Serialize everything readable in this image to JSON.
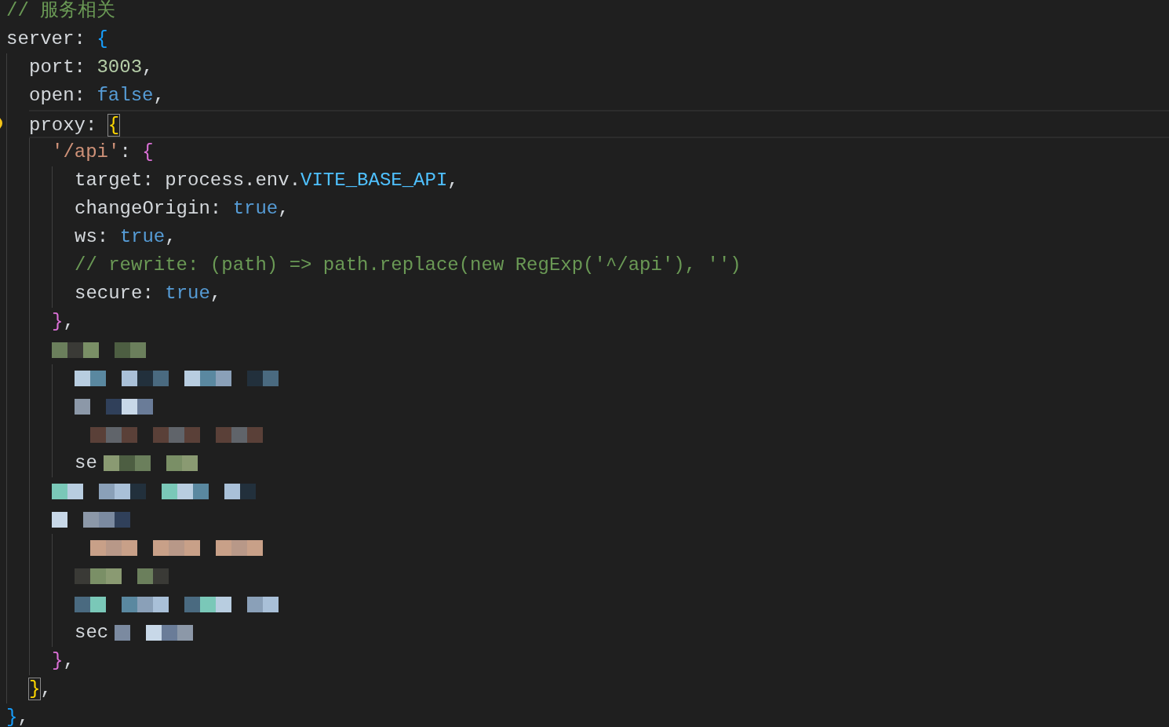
{
  "editor": {
    "lines": [
      {
        "kind": "code",
        "tokens": [
          {
            "kind": "comment",
            "text": "// 服务相关"
          }
        ]
      },
      {
        "kind": "code",
        "tokens": [
          {
            "kind": "key",
            "text": "server"
          },
          {
            "kind": "punct",
            "text": ": "
          },
          {
            "kind": "brace1",
            "text": "{"
          }
        ],
        "children": [
          {
            "kind": "code",
            "tokens": [
              {
                "kind": "key",
                "text": "port"
              },
              {
                "kind": "punct",
                "text": ": "
              },
              {
                "kind": "number",
                "text": "3003"
              },
              {
                "kind": "punct",
                "text": ","
              }
            ]
          },
          {
            "kind": "code",
            "tokens": [
              {
                "kind": "key",
                "text": "open"
              },
              {
                "kind": "punct",
                "text": ": "
              },
              {
                "kind": "keyword",
                "text": "false"
              },
              {
                "kind": "punct",
                "text": ","
              }
            ]
          },
          {
            "kind": "code",
            "current": true,
            "tokens": [
              {
                "kind": "key",
                "text": "proxy"
              },
              {
                "kind": "punct",
                "text": ": "
              },
              {
                "kind": "brace2",
                "text": "{",
                "matched": true
              }
            ],
            "children": [
              {
                "kind": "code",
                "tokens": [
                  {
                    "kind": "string",
                    "text": "'/api'"
                  },
                  {
                    "kind": "punct",
                    "text": ": "
                  },
                  {
                    "kind": "brace3",
                    "text": "{"
                  }
                ],
                "children": [
                  {
                    "kind": "code",
                    "tokens": [
                      {
                        "kind": "key",
                        "text": "target"
                      },
                      {
                        "kind": "punct",
                        "text": ": process.env."
                      },
                      {
                        "kind": "constant",
                        "text": "VITE_BASE_API"
                      },
                      {
                        "kind": "punct",
                        "text": ","
                      }
                    ]
                  },
                  {
                    "kind": "code",
                    "tokens": [
                      {
                        "kind": "key",
                        "text": "changeOrigin"
                      },
                      {
                        "kind": "punct",
                        "text": ": "
                      },
                      {
                        "kind": "keyword",
                        "text": "true"
                      },
                      {
                        "kind": "punct",
                        "text": ","
                      }
                    ]
                  },
                  {
                    "kind": "code",
                    "tokens": [
                      {
                        "kind": "key",
                        "text": "ws"
                      },
                      {
                        "kind": "punct",
                        "text": ": "
                      },
                      {
                        "kind": "keyword",
                        "text": "true"
                      },
                      {
                        "kind": "punct",
                        "text": ","
                      }
                    ]
                  },
                  {
                    "kind": "code",
                    "tokens": [
                      {
                        "kind": "comment",
                        "text": "// rewrite: (path) => path.replace(new RegExp('^/api'), '')"
                      }
                    ]
                  },
                  {
                    "kind": "code",
                    "tokens": [
                      {
                        "kind": "key",
                        "text": "secure"
                      },
                      {
                        "kind": "punct",
                        "text": ": "
                      },
                      {
                        "kind": "keyword",
                        "text": "true"
                      },
                      {
                        "kind": "punct",
                        "text": ","
                      }
                    ]
                  }
                ],
                "close": {
                  "kind": "code",
                  "tokens": [
                    {
                      "kind": "brace3",
                      "text": "}"
                    },
                    {
                      "kind": "punct",
                      "text": ","
                    }
                  ]
                }
              },
              {
                "kind": "redacted",
                "children": [
                  {
                    "kind": "redacted"
                  },
                  {
                    "kind": "redacted"
                  },
                  {
                    "kind": "redacted"
                  },
                  {
                    "kind": "redacted",
                    "visible": "se"
                  }
                ],
                "close": {
                  "kind": "redacted"
                }
              },
              {
                "kind": "redacted",
                "children": [
                  {
                    "kind": "redacted"
                  },
                  {
                    "kind": "redacted"
                  },
                  {
                    "kind": "redacted"
                  },
                  {
                    "kind": "redacted",
                    "visible": "sec"
                  }
                ],
                "close": {
                  "kind": "code",
                  "tokens": [
                    {
                      "kind": "brace3",
                      "text": "}"
                    },
                    {
                      "kind": "punct",
                      "text": ","
                    }
                  ]
                }
              }
            ],
            "close": {
              "kind": "code",
              "tokens": [
                {
                  "kind": "brace2",
                  "text": "}",
                  "matched": true
                },
                {
                  "kind": "punct",
                  "text": ","
                }
              ]
            }
          }
        ],
        "close": {
          "kind": "code",
          "tokens": [
            {
              "kind": "brace1",
              "text": "}"
            },
            {
              "kind": "punct",
              "text": ","
            }
          ]
        }
      }
    ]
  }
}
